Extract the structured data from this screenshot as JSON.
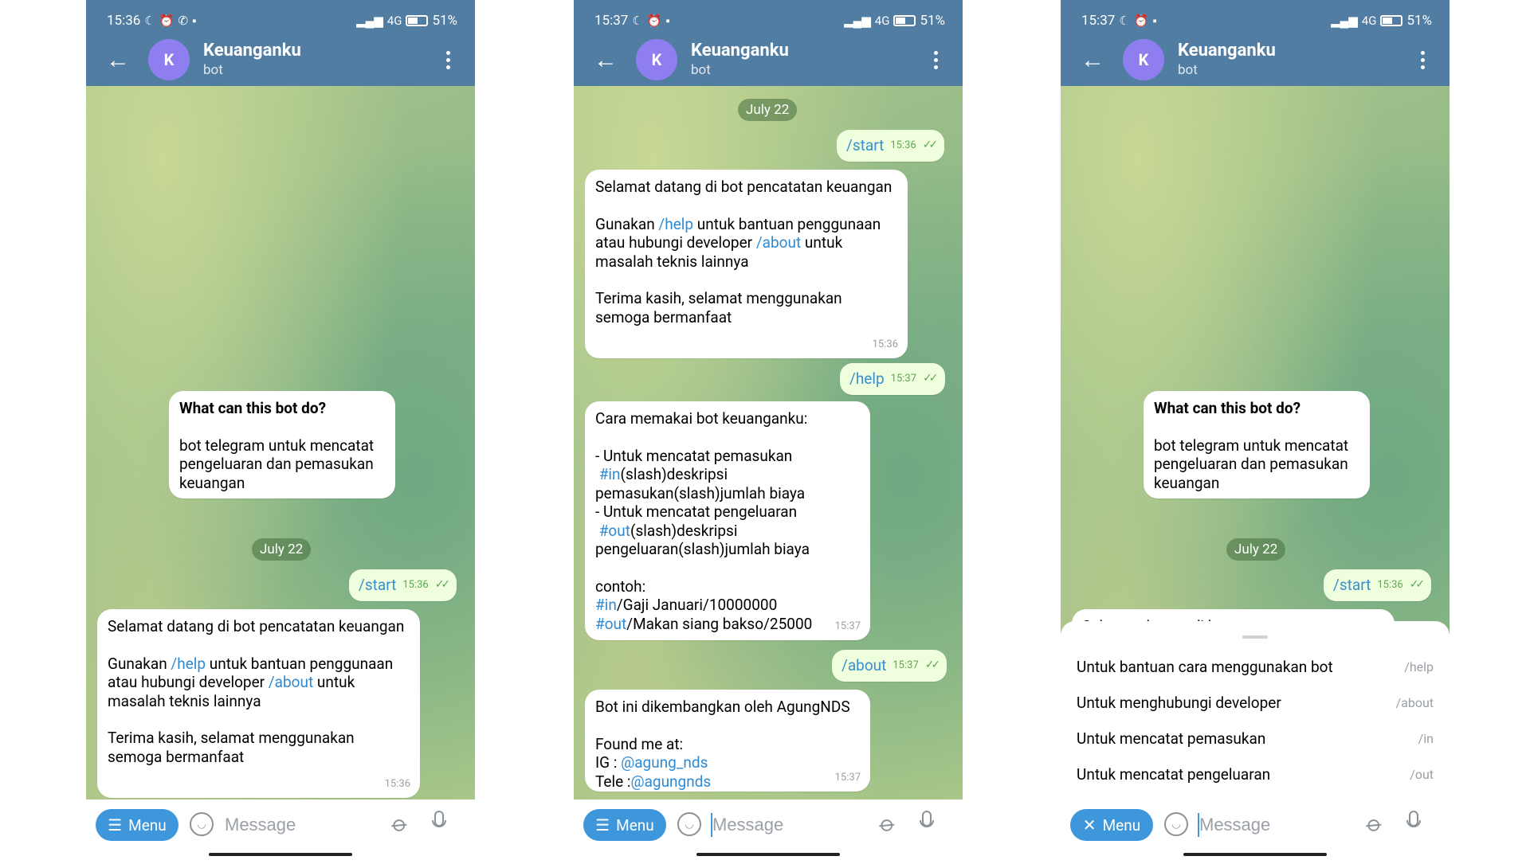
{
  "status_bars": [
    {
      "time": "15:36",
      "signal": "4G",
      "battery": "51%"
    },
    {
      "time": "15:37",
      "signal": "4G",
      "battery": "51%"
    },
    {
      "time": "15:37",
      "signal": "4G",
      "battery": "51%"
    }
  ],
  "chat": {
    "title": "Keuanganku",
    "subtitle": "bot",
    "avatar_letter": "K"
  },
  "intro": {
    "heading": "What can this bot do?",
    "text": "bot telegram untuk mencatat pengeluaran dan pemasukan keuangan"
  },
  "date_label": "July 22",
  "messages": {
    "start_cmd": "/start",
    "start_time": "15:36",
    "welcome_l1": "Selamat datang di bot pencatatan keuangan",
    "welcome_a": "Gunakan ",
    "welcome_help": "/help",
    "welcome_b": " untuk bantuan penggunaan atau hubungi developer ",
    "welcome_about": "/about",
    "welcome_c": " untuk masalah teknis lainnya",
    "welcome_l3": "Terima kasih, selamat menggunakan semoga bermanfaat",
    "welcome_time": "15:36",
    "help_cmd": "/help",
    "help_time": "15:37",
    "howto_l1": "Cara memakai bot keuanganku:",
    "howto_in_a": "- Untuk mencatat pemasukan",
    "howto_in_tag": "#in",
    "howto_in_b": "(slash)deskripsi pemasukan(slash)jumlah biaya",
    "howto_out_a": "- Untuk mencatat pengeluaran",
    "howto_out_tag": "#out",
    "howto_out_b": "(slash)deskripsi pengeluaran(slash)jumlah biaya",
    "howto_ex": "contoh:",
    "ex1_tag": "#in",
    "ex1_rest": "/Gaji Januari/10000000",
    "ex2_tag": "#out",
    "ex2_rest": "/Makan siang bakso/25000",
    "howto_time": "15:37",
    "about_cmd": "/about",
    "about_time": "15:37",
    "about_l1": "Bot ini dikembangkan oleh AgungNDS",
    "about_l2": "Found me at:",
    "about_ig_label": "IG : ",
    "about_ig": "@agung_nds",
    "about_tele_label": "Tele :",
    "about_tele": "@agungnds",
    "about_time2": "15:37",
    "cut_text": "Selamat datang di bot pencatatan"
  },
  "commands": [
    {
      "desc": "Untuk bantuan cara menggunakan bot",
      "cmd": "/help"
    },
    {
      "desc": "Untuk menghubungi developer",
      "cmd": "/about"
    },
    {
      "desc": "Untuk mencatat pemasukan",
      "cmd": "/in"
    },
    {
      "desc": "Untuk mencatat pengeluaran",
      "cmd": "/out"
    }
  ],
  "input": {
    "menu_label": "Menu",
    "placeholder": "Message"
  },
  "colors": {
    "header": "#517da2",
    "accent": "#3e96db",
    "link": "#2f8ad2",
    "outgoing": "#effedd",
    "avatar": "#8e7ef0"
  }
}
